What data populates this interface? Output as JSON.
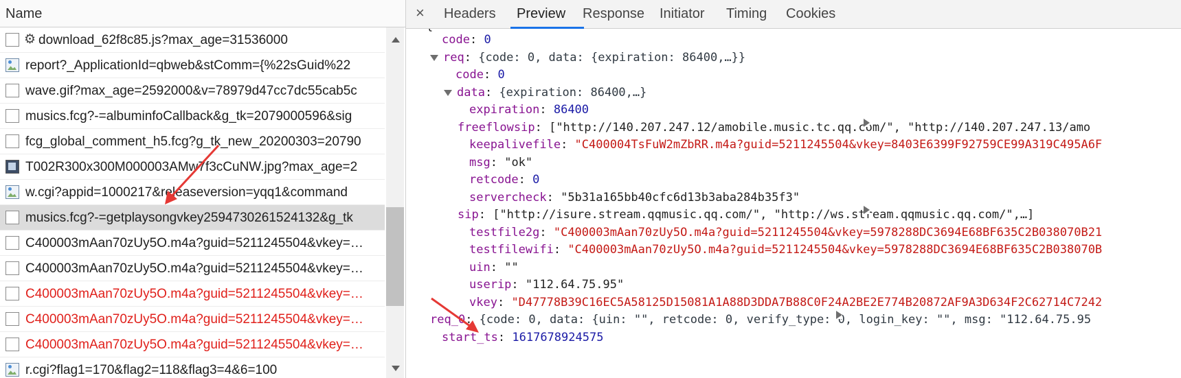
{
  "network": {
    "column_header": "Name",
    "requests": [
      {
        "name": "download_62f8c85.js?max_age=31536000",
        "icon": "gear-icon",
        "status": "ok"
      },
      {
        "name": "report?_ApplicationId=qbweb&stComm={%22sGuid%22",
        "icon": "image-file-icon",
        "status": "ok"
      },
      {
        "name": "wave.gif?max_age=2592000&v=78979d47cc7dc55cab5c",
        "icon": "document-icon",
        "status": "ok"
      },
      {
        "name": "musics.fcg?-=albuminfoCallback&g_tk=2079000596&sig",
        "icon": "document-icon",
        "status": "ok"
      },
      {
        "name": "fcg_global_comment_h5.fcg?g_tk_new_20200303=20790",
        "icon": "document-icon",
        "status": "ok"
      },
      {
        "name": "T002R300x300M000003AMw7f3cCuNW.jpg?max_age=2",
        "icon": "image-thumbnail-icon",
        "status": "ok"
      },
      {
        "name": "w.cgi?appid=1000217&releaseversion=yqq1&command",
        "icon": "image-file-icon",
        "status": "ok"
      },
      {
        "name": "musics.fcg?-=getplaysongvkey2594730261524132&g_tk",
        "icon": "document-icon",
        "status": "selected"
      },
      {
        "name": "C400003mAan70zUy5O.m4a?guid=5211245504&vkey=…",
        "icon": "document-icon",
        "status": "ok"
      },
      {
        "name": "C400003mAan70zUy5O.m4a?guid=5211245504&vkey=…",
        "icon": "document-icon",
        "status": "ok"
      },
      {
        "name": "C400003mAan70zUy5O.m4a?guid=5211245504&vkey=…",
        "icon": "document-icon",
        "status": "error"
      },
      {
        "name": "C400003mAan70zUy5O.m4a?guid=5211245504&vkey=…",
        "icon": "document-icon",
        "status": "error"
      },
      {
        "name": "C400003mAan70zUy5O.m4a?guid=5211245504&vkey=…",
        "icon": "document-icon",
        "status": "error"
      },
      {
        "name": "r.cgi?flag1=170&flag2=118&flag3=4&6=100",
        "icon": "image-file-icon",
        "status": "ok"
      }
    ],
    "selected_index": 7,
    "error_color": "#e0201b"
  },
  "details": {
    "close_label": "×",
    "tabs": [
      "Headers",
      "Preview",
      "Response",
      "Initiator",
      "Timing",
      "Cookies"
    ],
    "active_tab": "Preview",
    "accent_color": "#1a73e8"
  },
  "preview": {
    "code": {
      "key": "code",
      "value": "0"
    },
    "req": {
      "key": "req",
      "summary": "{code: 0, data: {expiration: 86400,…}}",
      "code": {
        "key": "code",
        "value": "0"
      },
      "data": {
        "key": "data",
        "summary": "{expiration: 86400,…}",
        "expiration": {
          "key": "expiration",
          "value": "86400"
        },
        "freeflowsip": {
          "key": "freeflowsip",
          "value": "[\"http://140.207.247.12/amobile.music.tc.qq.com/\", \"http://140.207.247.13/amo"
        },
        "keepalivefile": {
          "key": "keepalivefile",
          "value": "\"C400004TsFuW2mZbRR.m4a?guid=5211245504&vkey=8403E6399F92759CE99A319C495A6F"
        },
        "msg": {
          "key": "msg",
          "value": "\"ok\""
        },
        "retcode": {
          "key": "retcode",
          "value": "0"
        },
        "servercheck": {
          "key": "servercheck",
          "value": "\"5b31a165bb40cfc6d13b3aba284b35f3\""
        },
        "sip": {
          "key": "sip",
          "value": "[\"http://isure.stream.qqmusic.qq.com/\", \"http://ws.stream.qqmusic.qq.com/\",…]"
        },
        "testfile2g": {
          "key": "testfile2g",
          "value": "\"C400003mAan70zUy5O.m4a?guid=5211245504&vkey=5978288DC3694E68BF635C2B038070B21"
        },
        "testfilewifi": {
          "key": "testfilewifi",
          "value": "\"C400003mAan70zUy5O.m4a?guid=5211245504&vkey=5978288DC3694E68BF635C2B038070B"
        },
        "uin": {
          "key": "uin",
          "value": "\"\""
        },
        "userip": {
          "key": "userip",
          "value": "\"112.64.75.95\""
        },
        "vkey": {
          "key": "vkey",
          "value": "\"D47778B39C16EC5A58125D15081A1A88D3DDA7B88C0F24A2BE2E774B20872AF9A3D634F2C62714C7242"
        }
      }
    },
    "req_0": {
      "key": "req_0",
      "summary": "{code: 0, data: {uin: \"\", retcode: 0, verify_type: 0, login_key: \"\", msg: \"112.64.75.95"
    },
    "start_ts": {
      "key": "start_ts",
      "value": "1617678924575"
    },
    "top_clipped": "{"
  },
  "colors": {
    "key": "#881391",
    "number": "#1a1aa6",
    "string": "#c41a16",
    "annotation_arrow": "#e53935"
  }
}
